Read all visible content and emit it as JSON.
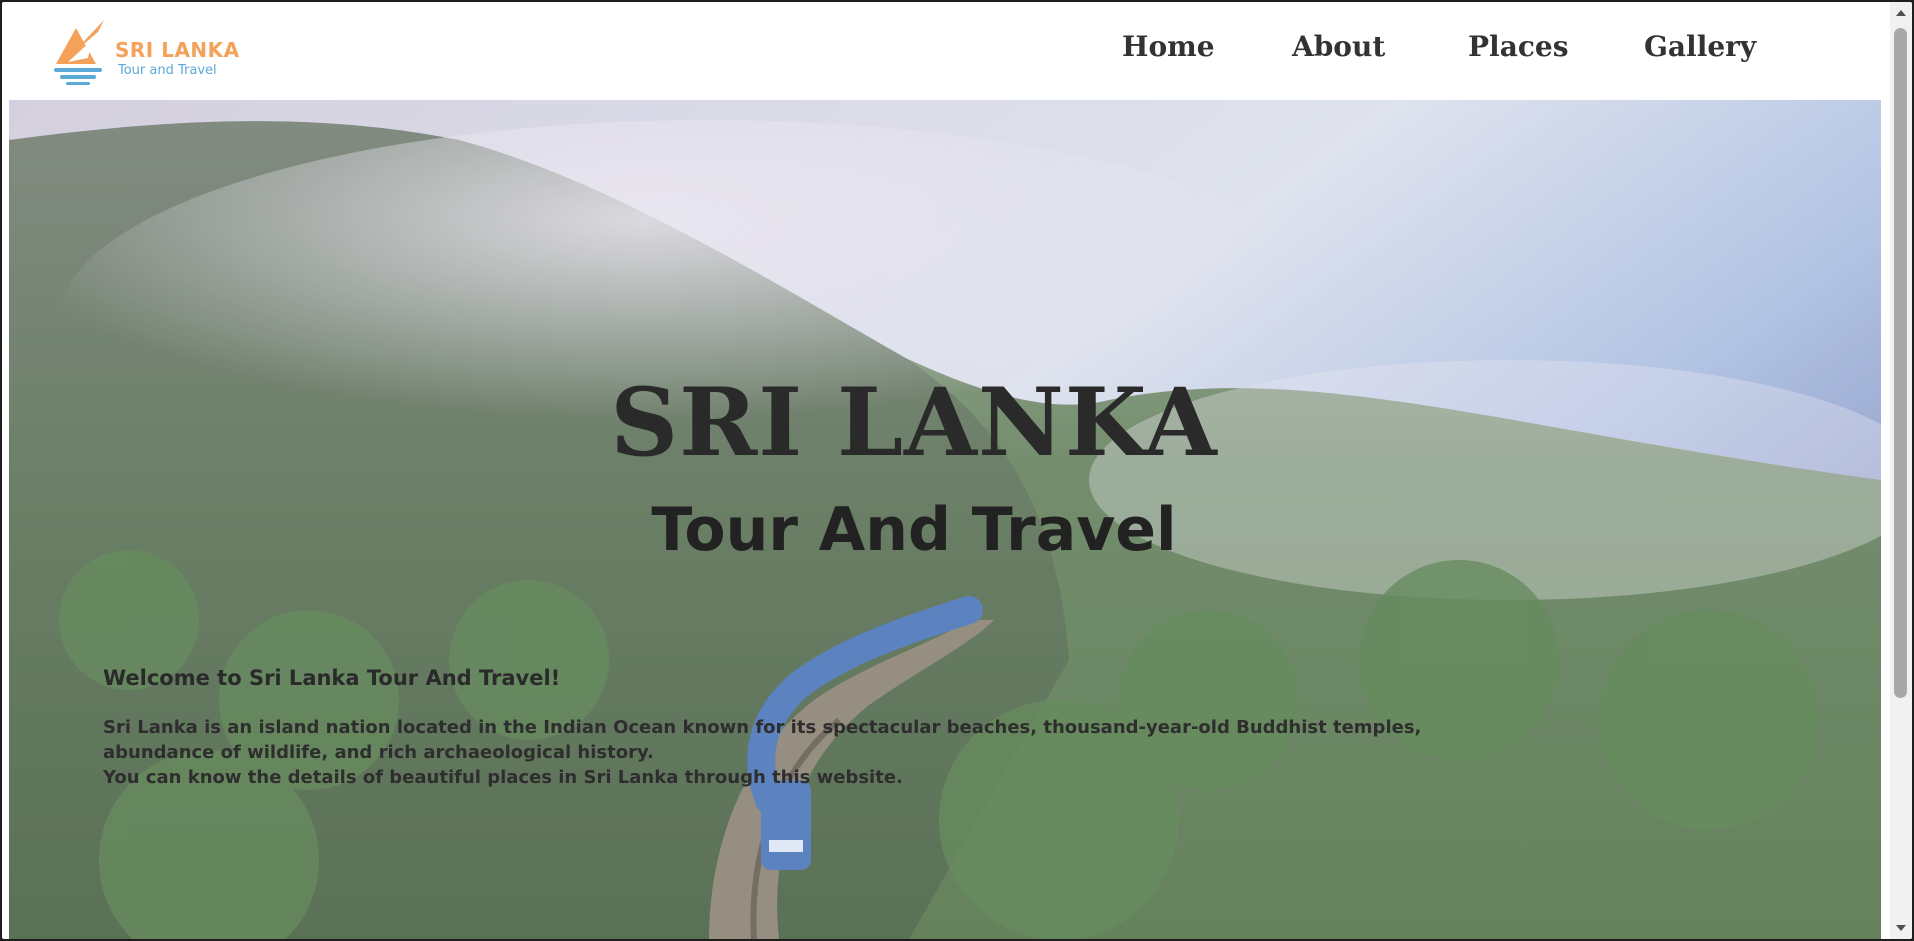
{
  "brand": {
    "name": "SRI LANKA",
    "tagline": "Tour and Travel",
    "accent_color": "#f4a259",
    "secondary_color": "#5aa9d6"
  },
  "nav": {
    "items": [
      {
        "label": "Home"
      },
      {
        "label": "About"
      },
      {
        "label": "Places"
      },
      {
        "label": "Gallery"
      }
    ]
  },
  "hero": {
    "title": "SRI LANKA",
    "subtitle": "Tour And Travel",
    "welcome": "Welcome to Sri Lanka Tour And Travel!",
    "description_lines": [
      "Sri Lanka is an island nation located in the Indian Ocean known for its spectacular beaches, thousand-year-old Buddhist temples,",
      "abundance of wildlife, and rich archaeological history.",
      "You can know the details of beautiful places in Sri Lanka through this website."
    ],
    "background_image": "misty-forest-train-bridge-image"
  }
}
